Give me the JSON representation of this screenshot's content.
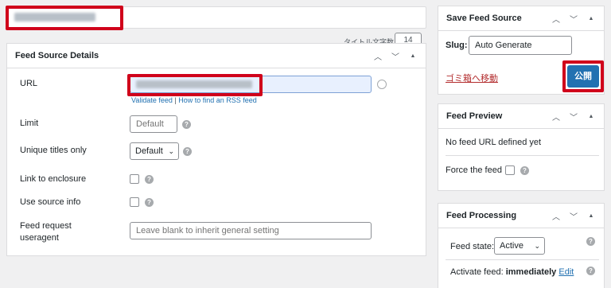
{
  "title_field": {
    "value": ""
  },
  "char_count": {
    "label": "タイトル文字数",
    "value": "14"
  },
  "feed_source_details": {
    "title": "Feed Source Details",
    "url": {
      "label": "URL",
      "validate_link": "Validate feed",
      "separator": "|",
      "howto_link": "How to find an RSS feed"
    },
    "limit": {
      "label": "Limit",
      "placeholder": "Default"
    },
    "unique_titles": {
      "label": "Unique titles only",
      "selected": "Default"
    },
    "link_enclosure": {
      "label": "Link to enclosure"
    },
    "use_source_info": {
      "label": "Use source info"
    },
    "useragent": {
      "label_line1": "Feed request",
      "label_line2": "useragent",
      "placeholder": "Leave blank to inherit general setting"
    }
  },
  "save_feed_source": {
    "title": "Save Feed Source",
    "slug_label": "Slug:",
    "slug_value": "Auto Generate",
    "trash_link": "ゴミ箱へ移動",
    "publish_button": "公開"
  },
  "feed_preview": {
    "title": "Feed Preview",
    "no_feed_text": "No feed URL defined yet",
    "force_label": "Force the feed"
  },
  "feed_processing": {
    "title": "Feed Processing",
    "state_label": "Feed state:",
    "state_value": "Active",
    "activate_label": "Activate feed:",
    "activate_value": "immediately",
    "edit_link": "Edit"
  },
  "icons": [
    "chevron-up-icon",
    "chevron-down-icon",
    "triangle-up-icon",
    "help-icon"
  ],
  "colors": {
    "accent": "#2271b1",
    "highlight": "#d0021b",
    "url_field_bg": "#e8f0fe",
    "trash": "#b32d2e"
  }
}
